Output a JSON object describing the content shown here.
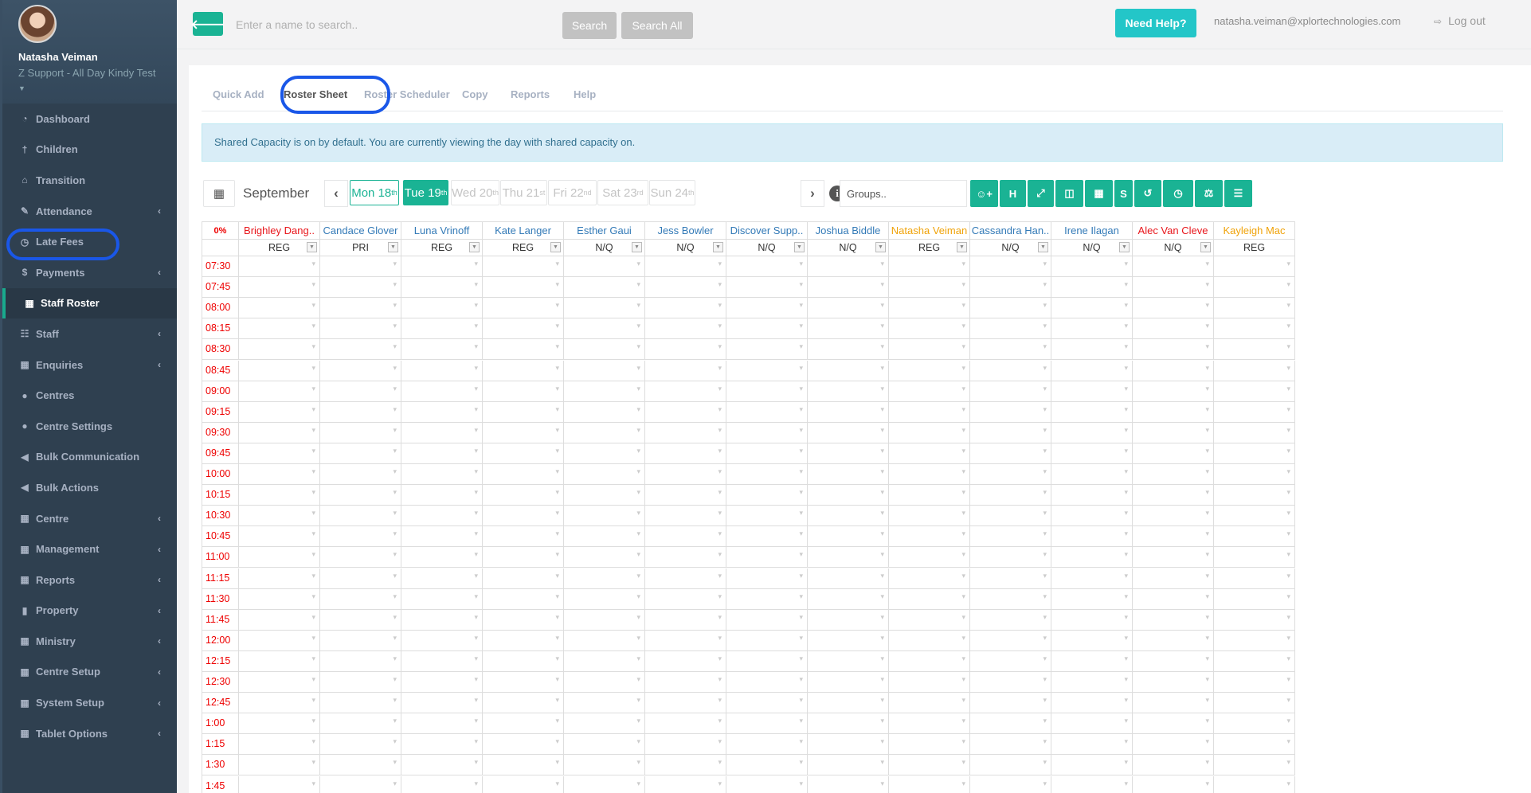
{
  "profile": {
    "name": "Natasha Veiman",
    "subtitle": "Z Support - All Day Kindy Test"
  },
  "sidebar": {
    "items": [
      {
        "label": "Dashboard",
        "icon": "dashboard-icon",
        "glyph": "◔",
        "chev": false
      },
      {
        "label": "Children",
        "icon": "child-icon",
        "glyph": "†",
        "chev": false
      },
      {
        "label": "Transition",
        "icon": "graduation-cap-icon",
        "glyph": "⌂",
        "chev": false
      },
      {
        "label": "Attendance",
        "icon": "edit-icon",
        "glyph": "✎",
        "chev": true
      },
      {
        "label": "Late Fees",
        "icon": "clock-icon",
        "glyph": "◷",
        "chev": false
      },
      {
        "label": "Payments",
        "icon": "dollar-icon",
        "glyph": "$",
        "chev": true
      },
      {
        "label": "Staff Roster",
        "icon": "calendar-icon",
        "glyph": "▦",
        "chev": false,
        "active": true
      },
      {
        "label": "Staff",
        "icon": "sitemap-icon",
        "glyph": "☷",
        "chev": true
      },
      {
        "label": "Enquiries",
        "icon": "grid-icon",
        "glyph": "▦",
        "chev": true
      },
      {
        "label": "Centres",
        "icon": "circle-icon",
        "glyph": "●",
        "chev": false
      },
      {
        "label": "Centre Settings",
        "icon": "circle-icon",
        "glyph": "●",
        "chev": false
      },
      {
        "label": "Bulk Communication",
        "icon": "bullhorn-icon",
        "glyph": "◀",
        "chev": false
      },
      {
        "label": "Bulk Actions",
        "icon": "bullhorn-icon",
        "glyph": "◀",
        "chev": false
      },
      {
        "label": "Centre",
        "icon": "grid-icon",
        "glyph": "▦",
        "chev": true
      },
      {
        "label": "Management",
        "icon": "grid-icon",
        "glyph": "▦",
        "chev": true
      },
      {
        "label": "Reports",
        "icon": "grid-icon",
        "glyph": "▦",
        "chev": true
      },
      {
        "label": "Property",
        "icon": "book-icon",
        "glyph": "▮",
        "chev": true
      },
      {
        "label": "Ministry",
        "icon": "grid-icon",
        "glyph": "▦",
        "chev": true
      },
      {
        "label": "Centre Setup",
        "icon": "grid-icon",
        "glyph": "▦",
        "chev": true
      },
      {
        "label": "System Setup",
        "icon": "grid-icon",
        "glyph": "▦",
        "chev": true
      },
      {
        "label": "Tablet Options",
        "icon": "grid-icon",
        "glyph": "▦",
        "chev": true
      }
    ]
  },
  "topbar": {
    "search_placeholder": "Enter a name to search..",
    "search_label": "Search",
    "search_all_label": "Search All",
    "help_label": "Need Help?",
    "email": "natasha.veiman@xplortechnologies.com",
    "logout_label": "Log out"
  },
  "tabs": [
    "Quick Add",
    "Roster Sheet",
    "Roster Scheduler",
    "Copy",
    "Reports",
    "Help"
  ],
  "active_tab": "Roster Sheet",
  "info_message": "Shared Capacity is on by default. You are currently viewing the day with shared capacity on.",
  "month": "September",
  "days": [
    {
      "label": "Mon 18",
      "sup": "th",
      "state": "outline"
    },
    {
      "label": "Tue 19",
      "sup": "th",
      "state": "filled"
    },
    {
      "label": "Wed 20",
      "sup": "th",
      "state": "disabled"
    },
    {
      "label": "Thu 21",
      "sup": "st",
      "state": "disabled"
    },
    {
      "label": "Fri 22",
      "sup": "nd",
      "state": "disabled"
    },
    {
      "label": "Sat 23",
      "sup": "rd",
      "state": "disabled"
    },
    {
      "label": "Sun 24",
      "sup": "th",
      "state": "disabled"
    }
  ],
  "groups_placeholder": "Groups..",
  "tool_buttons": [
    {
      "name": "add-staff-button",
      "glyph": "☺+"
    },
    {
      "name": "holiday-button",
      "glyph": "H"
    },
    {
      "name": "expand-button",
      "glyph": "⤢"
    },
    {
      "name": "columns-button",
      "glyph": "◫"
    },
    {
      "name": "calculator-button",
      "glyph": "▦"
    },
    {
      "name": "salary-button",
      "glyph": "S"
    },
    {
      "name": "history-button",
      "glyph": "↺"
    },
    {
      "name": "clock-button",
      "glyph": "◷"
    },
    {
      "name": "balance-button",
      "glyph": "⚖"
    },
    {
      "name": "menu-button",
      "glyph": "☰"
    }
  ],
  "roster": {
    "percent": "0%",
    "staff": [
      {
        "name": "Brighley Dang..",
        "type": "REG",
        "color": "#e8161b"
      },
      {
        "name": "Candace Glover",
        "type": "PRI",
        "color": "#337ab7"
      },
      {
        "name": "Luna Vrinoff",
        "type": "REG",
        "color": "#337ab7"
      },
      {
        "name": "Kate Langer",
        "type": "REG",
        "color": "#337ab7"
      },
      {
        "name": "Esther Gaui",
        "type": "N/Q",
        "color": "#337ab7"
      },
      {
        "name": "Jess Bowler",
        "type": "N/Q",
        "color": "#337ab7"
      },
      {
        "name": "Discover Supp..",
        "type": "N/Q",
        "color": "#337ab7"
      },
      {
        "name": "Joshua Biddle",
        "type": "N/Q",
        "color": "#337ab7"
      },
      {
        "name": "Natasha Veiman",
        "type": "REG",
        "color": "#f0a30a"
      },
      {
        "name": "Cassandra Han..",
        "type": "N/Q",
        "color": "#337ab7"
      },
      {
        "name": "Irene Ilagan",
        "type": "N/Q",
        "color": "#337ab7"
      },
      {
        "name": "Alec Van Cleve",
        "type": "N/Q",
        "color": "#e8161b"
      },
      {
        "name": "Kayleigh Mac",
        "type": "REG",
        "color": "#f0a30a"
      }
    ],
    "times": [
      "07:30",
      "07:45",
      "08:00",
      "08:15",
      "08:30",
      "08:45",
      "09:00",
      "09:15",
      "09:30",
      "09:45",
      "10:00",
      "10:15",
      "10:30",
      "10:45",
      "11:00",
      "11:15",
      "11:30",
      "11:45",
      "12:00",
      "12:15",
      "12:30",
      "12:45",
      "1:00",
      "1:15",
      "1:30",
      "1:45"
    ]
  }
}
